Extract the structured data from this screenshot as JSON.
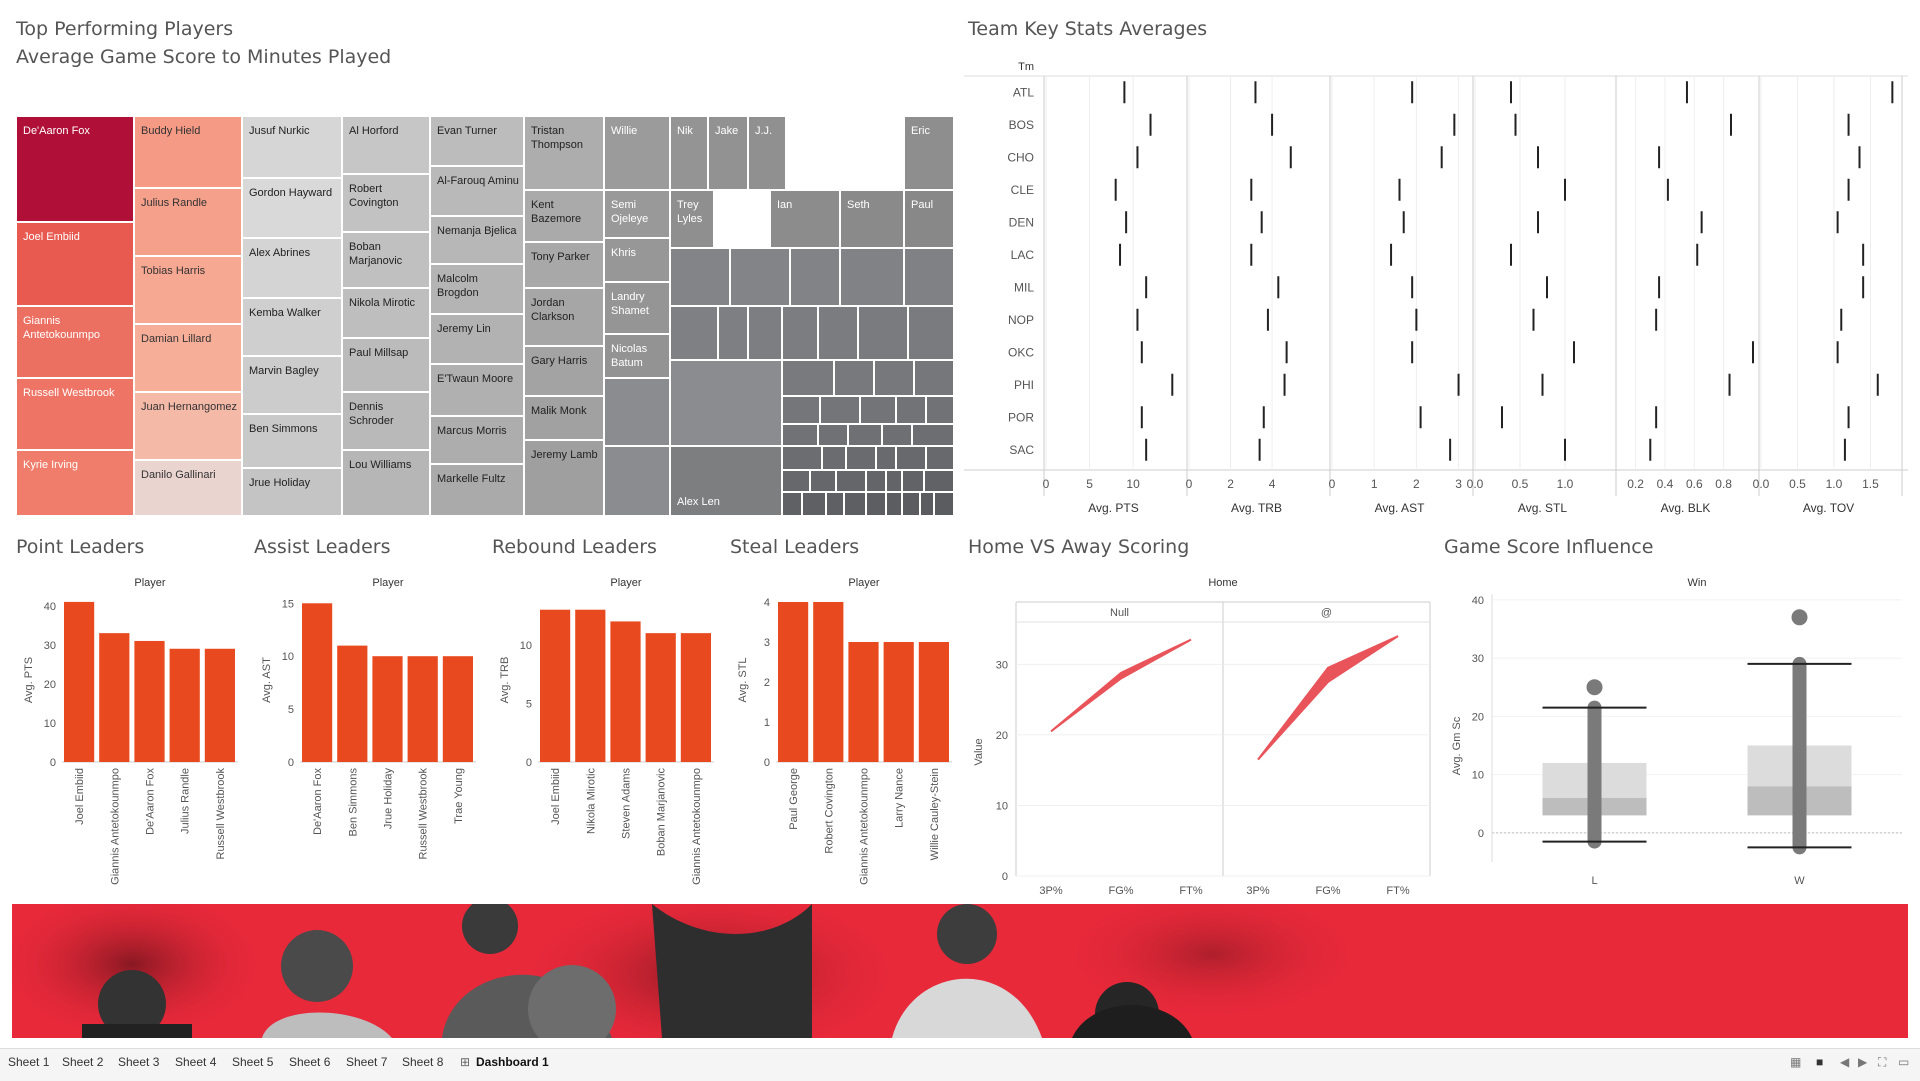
{
  "colors": {
    "orange": "#e9491f",
    "red_dark": "#b01038",
    "gray": "#8f9294",
    "box_light": "#dcdcdc",
    "box_dark": "#bdbdbd",
    "dot": "#7a7a7a",
    "area": "#e8545a",
    "banner": "#e8293a"
  },
  "panels": {
    "treemap_title_1": "Top Performing Players",
    "treemap_title_2": "Average Game Score to Minutes Played",
    "team_stats_title": "Team Key Stats Averages",
    "point_leaders_title": "Point Leaders",
    "assist_leaders_title": "Assist Leaders",
    "rebound_leaders_title": "Rebound Leaders",
    "steal_leaders_title": "Steal Leaders",
    "home_away_title": "Home VS Away Scoring",
    "game_score_title": "Game Score Influence"
  },
  "treemap": {
    "players": [
      {
        "name": "De'Aaron Fox",
        "color": "#b01038"
      },
      {
        "name": "Joel Embiid",
        "color": "#e85a4f"
      },
      {
        "name": "Giannis Antetokounmpo",
        "color": "#eb7062"
      },
      {
        "name": "Russell Westbrook",
        "color": "#ee7565"
      },
      {
        "name": "Kyrie Irving",
        "color": "#f07d6b"
      },
      {
        "name": "Buddy Hield",
        "color": "#f59a85"
      },
      {
        "name": "Julius Randle",
        "color": "#f5a08b"
      },
      {
        "name": "Tobias Harris",
        "color": "#f7a892"
      },
      {
        "name": "Damian Lillard",
        "color": "#f7ae98"
      },
      {
        "name": "Juan Hernangomez",
        "color": "#f5b9a8"
      },
      {
        "name": "Danilo Gallinari",
        "color": "#ead4d0"
      },
      {
        "name": "Jusuf Nurkic",
        "color": "#d6d6d6"
      },
      {
        "name": "Gordon Hayward",
        "color": "#d9d9d9"
      },
      {
        "name": "Alex Abrines",
        "color": "#d4d4d4"
      },
      {
        "name": "Kemba Walker",
        "color": "#cfcfcf"
      },
      {
        "name": "Marvin Bagley",
        "color": "#cccccc"
      },
      {
        "name": "Ben Simmons",
        "color": "#c9c9c9"
      },
      {
        "name": "Jrue Holiday",
        "color": "#c4c4c4"
      },
      {
        "name": "Al Horford",
        "color": "#c6c6c6"
      },
      {
        "name": "Robert Covington",
        "color": "#c2c2c2"
      },
      {
        "name": "Boban Marjanovic",
        "color": "#c0c0c0"
      },
      {
        "name": "Nikola Mirotic",
        "color": "#bebebe"
      },
      {
        "name": "Paul Millsap",
        "color": "#bbbbbb"
      },
      {
        "name": "Dennis Schroder",
        "color": "#b9b9b9"
      },
      {
        "name": "Lou Williams",
        "color": "#b6b6b6"
      },
      {
        "name": "Evan Turner",
        "color": "#bcbcbc"
      },
      {
        "name": "Al-Farouq Aminu",
        "color": "#b9b9b9"
      },
      {
        "name": "Nemanja Bjelica",
        "color": "#b7b7b7"
      },
      {
        "name": "Malcolm Brogdon",
        "color": "#b4b4b4"
      },
      {
        "name": "Jeremy Lin",
        "color": "#b2b2b2"
      },
      {
        "name": "E'Twaun Moore",
        "color": "#b0b0b0"
      },
      {
        "name": "Marcus Morris",
        "color": "#adadad"
      },
      {
        "name": "Markelle Fultz",
        "color": "#aaaaaa"
      },
      {
        "name": "Tristan Thompson",
        "color": "#adadad"
      },
      {
        "name": "Kent Bazemore",
        "color": "#abaaaa"
      },
      {
        "name": "Tony Parker",
        "color": "#a8a8a8"
      },
      {
        "name": "Jordan Clarkson",
        "color": "#a6a6a6"
      },
      {
        "name": "Gary Harris",
        "color": "#a3a3a3"
      },
      {
        "name": "Malik Monk",
        "color": "#a1a1a1"
      },
      {
        "name": "Jeremy Lamb",
        "color": "#9f9f9f"
      },
      {
        "name": "Willie",
        "color": "#9b9b9b"
      },
      {
        "name": "Semi Ojeleye",
        "color": "#999999"
      },
      {
        "name": "Khris",
        "color": "#979797"
      },
      {
        "name": "Landry Shamet",
        "color": "#959595"
      },
      {
        "name": "Nicolas Batum",
        "color": "#939393"
      },
      {
        "name": "Nik",
        "color": "#949494"
      },
      {
        "name": "Jake",
        "color": "#929292"
      },
      {
        "name": "J.J.",
        "color": "#909090"
      },
      {
        "name": "Eric",
        "color": "#8e8e8e"
      },
      {
        "name": "Trey Lyles",
        "color": "#8f8f8f"
      },
      {
        "name": "Ian",
        "color": "#8c8c8c"
      },
      {
        "name": "Seth",
        "color": "#8a8a8a"
      },
      {
        "name": "Paul",
        "color": "#888888"
      },
      {
        "name": "Alex Len",
        "color": "#7c7e80"
      }
    ]
  },
  "team_stats": {
    "row_header": "Tm",
    "teams": [
      "ATL",
      "BOS",
      "CHO",
      "CLE",
      "DEN",
      "LAC",
      "MIL",
      "NOP",
      "OKC",
      "PHI",
      "POR",
      "SAC"
    ],
    "metrics": [
      {
        "label": "Avg. PTS",
        "ticks": [
          "0",
          "5",
          "10"
        ],
        "range": [
          0,
          15.5
        ],
        "values": [
          9,
          12,
          10.5,
          8,
          9.2,
          8.5,
          11.5,
          10.5,
          11,
          14.5,
          11,
          11.5
        ]
      },
      {
        "label": "Avg. TRB",
        "ticks": [
          "0",
          "2",
          "4"
        ],
        "range": [
          0,
          6.5
        ],
        "values": [
          3.2,
          4,
          4.9,
          3,
          3.5,
          3,
          4.3,
          3.8,
          4.7,
          4.6,
          3.6,
          3.4
        ]
      },
      {
        "label": "Avg. AST",
        "ticks": [
          "0",
          "1",
          "2",
          "3"
        ],
        "range": [
          0,
          3.2
        ],
        "values": [
          1.9,
          2.9,
          2.6,
          1.6,
          1.7,
          1.4,
          1.9,
          2,
          1.9,
          3,
          2.1,
          2.8
        ]
      },
      {
        "label": "Avg. STL",
        "ticks": [
          "0.0",
          "0.5",
          "1.0"
        ],
        "range": [
          0,
          1.5
        ],
        "values": [
          0.4,
          0.45,
          0.7,
          1,
          0.7,
          0.4,
          0.8,
          0.65,
          1.1,
          0.75,
          0.3,
          1
        ]
      },
      {
        "label": "Avg. BLK",
        "ticks": [
          "0.2",
          "0.4",
          "0.6",
          "0.8"
        ],
        "range": [
          0.08,
          1
        ],
        "values": [
          0.55,
          0.85,
          0.36,
          0.42,
          0.65,
          0.62,
          0.36,
          0.34,
          1,
          0.84,
          0.34,
          0.3
        ]
      },
      {
        "label": "Avg. TOV",
        "ticks": [
          "0.0",
          "0.5",
          "1.0",
          "1.5"
        ],
        "range": [
          0,
          1.85
        ],
        "values": [
          1.8,
          1.2,
          1.35,
          1.2,
          1.05,
          1.4,
          1.4,
          1.1,
          1.05,
          1.6,
          1.2,
          1.15
        ]
      }
    ]
  },
  "leaders": [
    {
      "key": "points",
      "ylabel": "Avg. PTS",
      "yticks": [
        "0",
        "10",
        "20",
        "30",
        "40"
      ],
      "ymax": 42,
      "header": "Player",
      "players": [
        "Joel Embiid",
        "Giannis Antetokounmpo",
        "De'Aaron Fox",
        "Julius Randle",
        "Russell Westbrook"
      ],
      "values": [
        41,
        33,
        31,
        29,
        29
      ]
    },
    {
      "key": "assists",
      "ylabel": "Avg. AST",
      "yticks": [
        "0",
        "5",
        "10",
        "15"
      ],
      "ymax": 15.5,
      "header": "Player",
      "players": [
        "De'Aaron Fox",
        "Ben Simmons",
        "Jrue Holiday",
        "Russell Westbrook",
        "Trae Young"
      ],
      "values": [
        15,
        11,
        10,
        10,
        10
      ]
    },
    {
      "key": "rebounds",
      "ylabel": "Avg. TRB",
      "yticks": [
        "0",
        "5",
        "10"
      ],
      "ymax": 14,
      "header": "Player",
      "players": [
        "Joel Embiid",
        "Nikola Mirotic",
        "Steven Adams",
        "Boban Marjanovic",
        "Giannis Antetokounmpo"
      ],
      "values": [
        13,
        13,
        12,
        11,
        11
      ]
    },
    {
      "key": "steals",
      "ylabel": "Avg. STL",
      "yticks": [
        "0",
        "1",
        "2",
        "3",
        "4"
      ],
      "ymax": 4.1,
      "header": "Player",
      "players": [
        "Paul George",
        "Robert Covington",
        "Giannis Antetokounmpo",
        "Larry Nance",
        "Willie Cauley-Stein"
      ],
      "values": [
        4,
        4,
        3,
        3,
        3
      ]
    }
  ],
  "home_away": {
    "header": "Home",
    "panels": [
      "Null",
      "@"
    ],
    "ylabel": "Value",
    "yticks": [
      "0",
      "10",
      "20",
      "30"
    ],
    "ymax": 36,
    "xlabels": [
      "3P%",
      "FG%",
      "FT%"
    ],
    "upper": [
      [
        20.5,
        28.8,
        33.5
      ],
      [
        16.5,
        29.5,
        34
      ]
    ],
    "lower": [
      [
        20.5,
        28,
        33.5
      ],
      [
        16.5,
        27.5,
        34
      ]
    ]
  },
  "game_score": {
    "header": "Win",
    "ylabel": "Avg. Gm Sc",
    "yticks": [
      "0",
      "10",
      "20",
      "30",
      "40"
    ],
    "ymin": -5,
    "ymax": 41,
    "groups": [
      {
        "label": "L",
        "whisker_low": -1.5,
        "q1": 3,
        "median": 6,
        "q3": 12,
        "whisker_high": 21.5,
        "outlier": 25
      },
      {
        "label": "W",
        "whisker_low": -2.5,
        "q1": 3,
        "median": 8,
        "q3": 15,
        "whisker_high": 29,
        "outlier": 37
      }
    ]
  },
  "tabs": [
    "Sheet 1",
    "Sheet 2",
    "Sheet 3",
    "Sheet 4",
    "Sheet 5",
    "Sheet 6",
    "Sheet 7",
    "Sheet 8",
    "Dashboard 1"
  ]
}
